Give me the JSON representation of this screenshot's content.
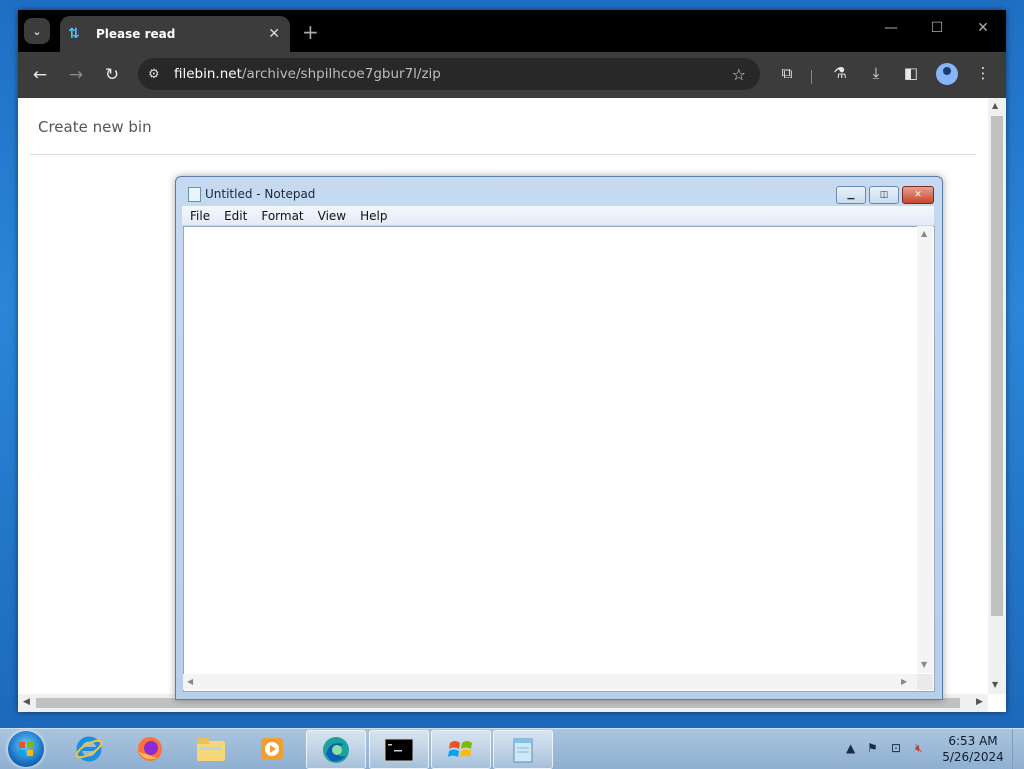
{
  "browser": {
    "tab": {
      "title": "Please read"
    },
    "new_tab_symbol": "+",
    "window_controls": {
      "minimize": "—",
      "maximize": "☐",
      "close": "✕"
    },
    "nav": {
      "back": "←",
      "forward": "→",
      "reload": "↻"
    },
    "address": {
      "host": "filebin.net",
      "path": "/archive/shpilhcoe7gbur7l/zip"
    }
  },
  "page": {
    "create_link": "Create new bin"
  },
  "notepad": {
    "title": "Untitled - Notepad",
    "menu": [
      "File",
      "Edit",
      "Format",
      "View",
      "Help"
    ],
    "content": ""
  },
  "taskbar": {
    "apps": [
      "internet-explorer",
      "firefox",
      "file-explorer",
      "media-player",
      "edge",
      "command-prompt",
      "windows-flag-app",
      "notepad"
    ],
    "clock": {
      "time": "6:53 AM",
      "date": "5/26/2024"
    }
  },
  "colors": {
    "chrome_dark": "#3c3c3c",
    "tabstrip": "#000000",
    "desktop": "#2b86d9",
    "taskbar": "#a9c4de"
  }
}
